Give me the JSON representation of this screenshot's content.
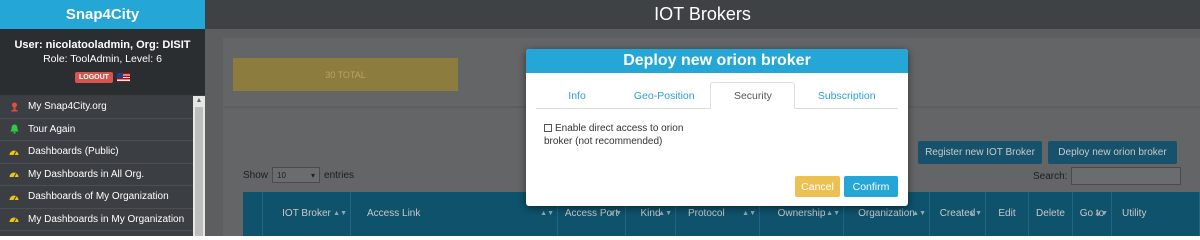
{
  "sidebar": {
    "brand": "Snap4City",
    "user_line": "User: nicolatooladmin, Org: DISIT",
    "role_line": "Role: ToolAdmin, Level: 6",
    "logout_label": "LOGOUT",
    "items": [
      {
        "label": "My Snap4City.org",
        "icon": "pin-icon",
        "color": "#e74c3c"
      },
      {
        "label": "Tour Again",
        "icon": "bell-icon",
        "color": "#2ecc40"
      },
      {
        "label": "Dashboards (Public)",
        "icon": "dashboard-icon",
        "color": "#f1c40f"
      },
      {
        "label": "My Dashboards in All Org.",
        "icon": "dashboard-icon",
        "color": "#f1c40f"
      },
      {
        "label": "Dashboards of My Organization",
        "icon": "dashboard-icon",
        "color": "#f1c40f"
      },
      {
        "label": "My Dashboards in My Organization",
        "icon": "dashboard-icon",
        "color": "#f1c40f"
      }
    ]
  },
  "header": {
    "title": "IOT Brokers"
  },
  "main": {
    "total_label": "30 TOTAL",
    "register_button": "Register new IOT Broker",
    "deploy_button": "Deploy new orion broker",
    "show_label": "Show",
    "entries_value": "10",
    "entries_label": "entries",
    "search_label": "Search:",
    "columns": [
      "IOT Broker",
      "Access Link",
      "Access Port",
      "Kind",
      "Protocol",
      "Ownership",
      "Organization",
      "Created",
      "Edit",
      "Delete",
      "Go to",
      "Utility"
    ]
  },
  "modal": {
    "title": "Deploy new orion broker",
    "tabs": [
      "Info",
      "Geo-Position",
      "Security",
      "Subscription"
    ],
    "active_tab": "Security",
    "checkbox_label": "Enable direct access to orion broker (not recommended)",
    "cancel_label": "Cancel",
    "confirm_label": "Confirm"
  },
  "colors": {
    "accent": "#24a6d6",
    "cancel": "#ecc152",
    "table_header": "#0f526c"
  }
}
